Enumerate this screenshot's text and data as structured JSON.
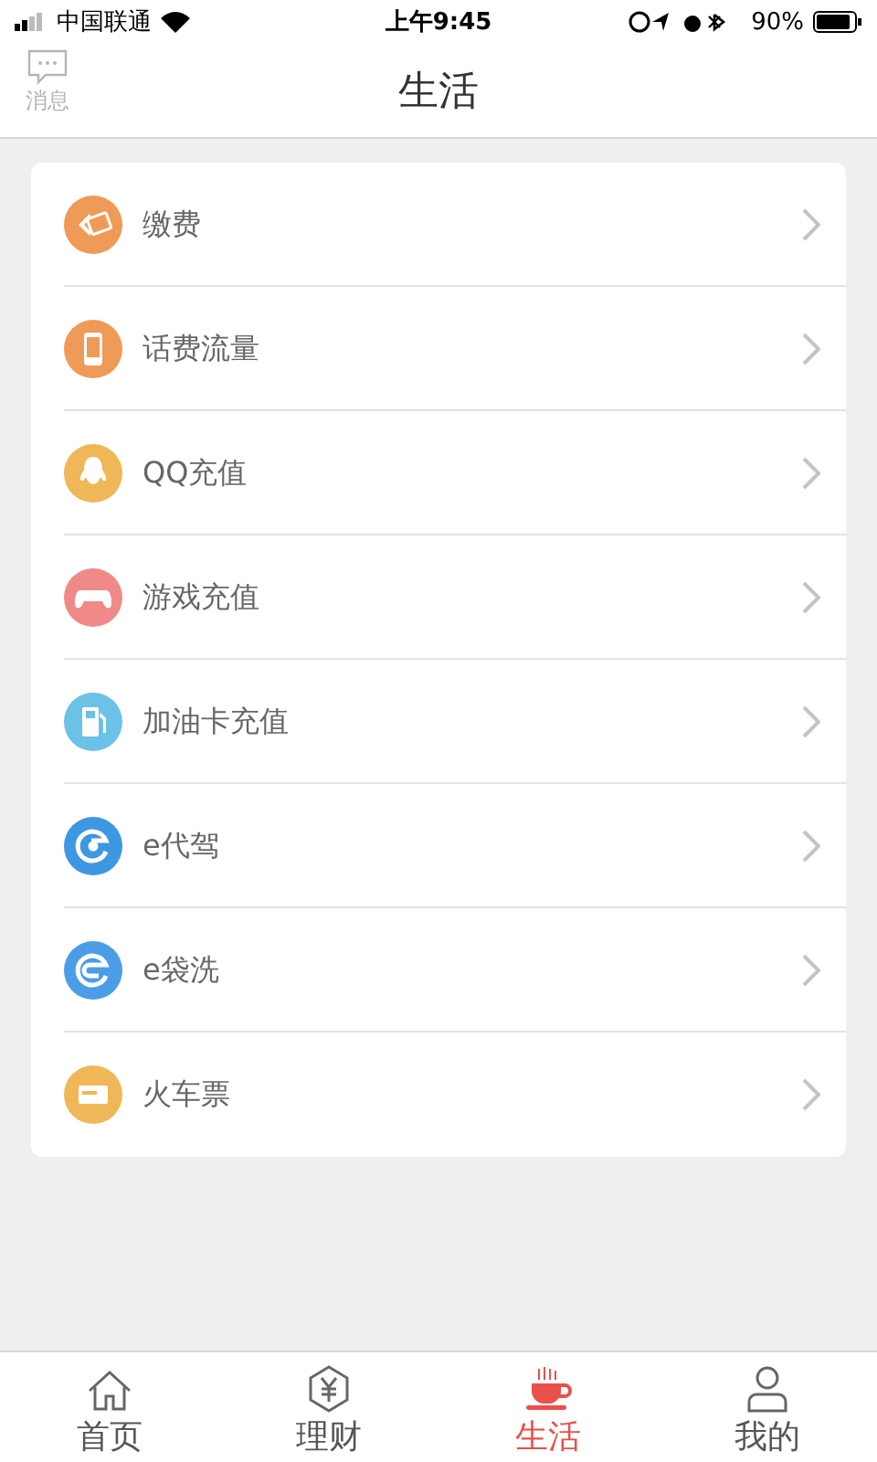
{
  "status_bar": {
    "carrier": "中国联通",
    "time": "上午9:45",
    "battery": "90%"
  },
  "nav_bar": {
    "title": "生活",
    "left_button": {
      "label": "消息"
    }
  },
  "services": [
    {
      "label": "缴费",
      "kind": "card",
      "color": "#ef9a56"
    },
    {
      "label": "话费流量",
      "kind": "phone",
      "color": "#ef9a56"
    },
    {
      "label": "QQ充值",
      "kind": "penguin",
      "color": "#efb757"
    },
    {
      "label": "游戏充值",
      "kind": "gamepad",
      "color": "#ef8a88"
    },
    {
      "label": "加油卡充值",
      "kind": "fuel",
      "color": "#6cc1e6"
    },
    {
      "label": "e代驾",
      "kind": "driver",
      "color": "#3d97e1"
    },
    {
      "label": "e袋洗",
      "kind": "laundry",
      "color": "#4b9de8"
    },
    {
      "label": "火车票",
      "kind": "ticket",
      "color": "#efb757"
    }
  ],
  "tab_bar": [
    {
      "label": "首页",
      "kind": "home",
      "selected": false
    },
    {
      "label": "理财",
      "kind": "finance",
      "selected": false
    },
    {
      "label": "生活",
      "kind": "life",
      "selected": true
    },
    {
      "label": "我的",
      "kind": "me",
      "selected": false
    }
  ]
}
